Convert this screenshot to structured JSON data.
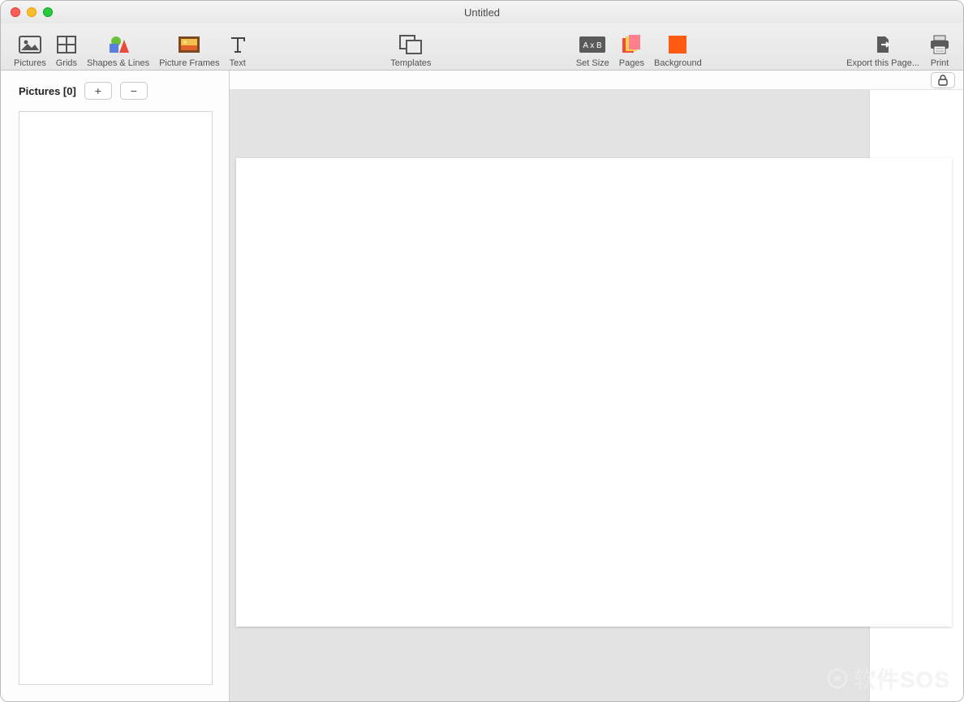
{
  "window": {
    "title": "Untitled"
  },
  "toolbar": {
    "pictures": "Pictures",
    "grids": "Grids",
    "shapes_lines": "Shapes & Lines",
    "picture_frames": "Picture Frames",
    "text": "Text",
    "templates": "Templates",
    "set_size": "Set Size",
    "pages": "Pages",
    "background": "Background",
    "export": "Export this Page...",
    "print": "Print"
  },
  "sidebar": {
    "title": "Pictures [0]",
    "add": "+",
    "remove": "−"
  },
  "watermark": "软件SOS"
}
